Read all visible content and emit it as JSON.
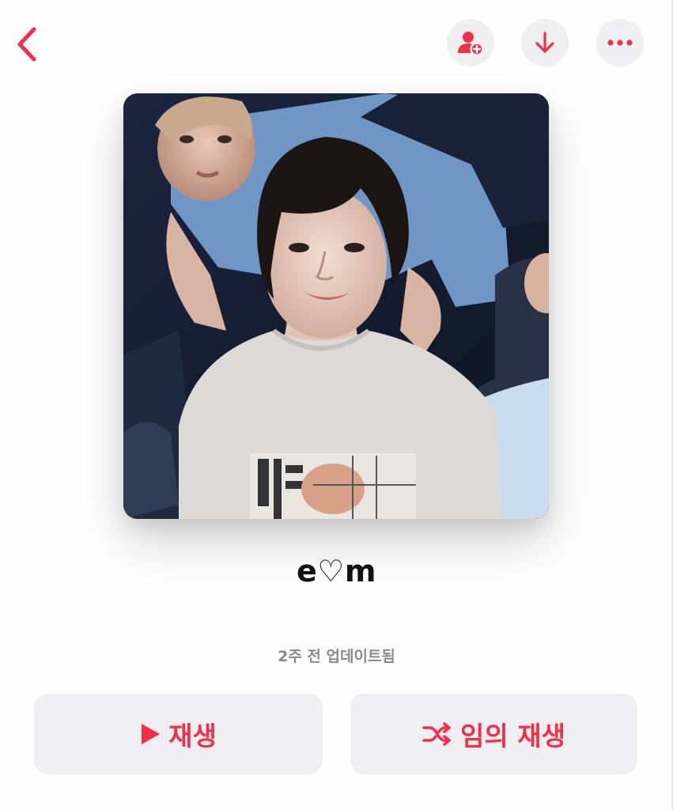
{
  "nav": {
    "back_icon": "chevron-left-icon",
    "actions": [
      {
        "icon": "person-add-icon"
      },
      {
        "icon": "arrow-down-icon"
      },
      {
        "icon": "more-horizontal-icon"
      }
    ]
  },
  "playlist": {
    "title": "e♡m",
    "updated_text": "2주 전 업데이트됨"
  },
  "buttons": {
    "play_label": "재생",
    "play_icon": "play-icon",
    "shuffle_label": "임의 재생",
    "shuffle_icon": "shuffle-icon"
  },
  "colors": {
    "accent": "#f0304a",
    "button_bg": "#efeff1",
    "secondary_text": "#8a8a8e"
  }
}
